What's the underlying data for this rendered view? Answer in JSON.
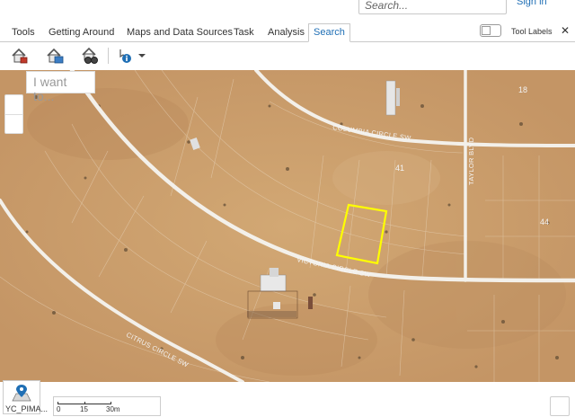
{
  "header": {
    "search_placeholder": "Search...",
    "signin_label": "Sign in"
  },
  "tabs": [
    {
      "label": "Tools"
    },
    {
      "label": "Getting Around"
    },
    {
      "label": "Maps and Data Sources"
    },
    {
      "label": "Task"
    },
    {
      "label": "Analysis"
    },
    {
      "label": "Search",
      "active": true
    }
  ],
  "tool_labels": {
    "label": "Tool Labels",
    "enabled": false
  },
  "toolbar": {
    "icons": [
      "search-parcel-icon",
      "search-address-icon",
      "search-binoculars-icon",
      "identify-icon"
    ]
  },
  "map": {
    "i_want_to_placeholder": "I want to...",
    "roads": {
      "columbia": "COLUMBIA CIRCLE SW",
      "victoria": "VICTORIA CIRCLE SW",
      "citrus": "CITRUS CIRCLE SW",
      "taylor": "TAYLOR BLVD"
    },
    "lot_numbers": [
      "18",
      "41",
      "44"
    ],
    "highlight_color": "#ffff00"
  },
  "basemap": {
    "label": "YC_PIMA..."
  },
  "scale": {
    "labels": [
      "0",
      "15",
      "30m"
    ]
  }
}
